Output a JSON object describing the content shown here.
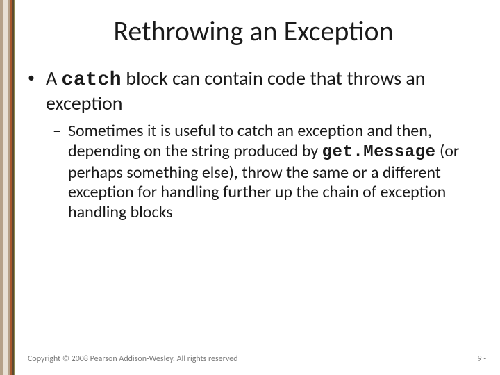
{
  "title": "Rethrowing an Exception",
  "bullet1": {
    "prefix": "A ",
    "code": "catch",
    "suffix": " block can contain code that throws an exception"
  },
  "sub1": {
    "prefix": "Sometimes it is useful to catch an exception and then, depending on the string produced by ",
    "code": "get.Message",
    "suffix": " (or perhaps something else), throw the same or a different exception for handling further up the chain of exception handling blocks"
  },
  "footer": {
    "copyright": "Copyright © 2008 Pearson Addison-Wesley. All rights reserved",
    "page": "9 -"
  }
}
